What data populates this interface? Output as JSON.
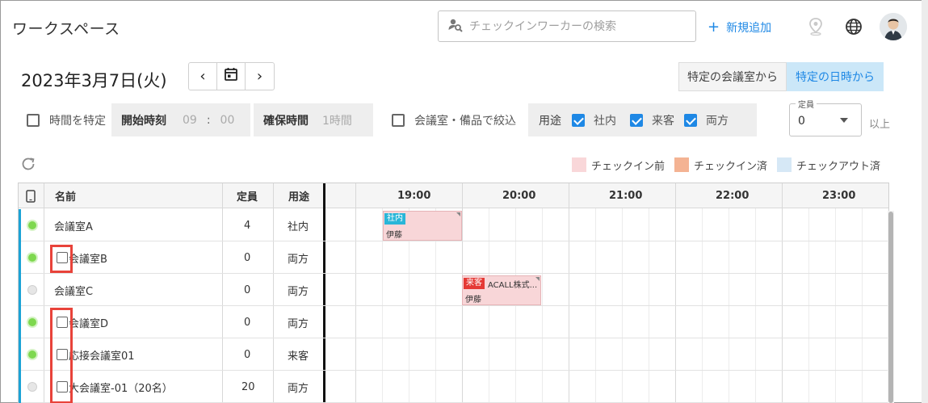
{
  "header": {
    "app_title": "ワークスペース",
    "search_placeholder": "チェックインワーカーの検索",
    "new_label": "新規追加",
    "icons": [
      "location-pin-icon",
      "globe-icon",
      "user-avatar"
    ]
  },
  "date": {
    "title": "2023年3月7日(火)",
    "prev": "‹",
    "next": "›"
  },
  "view_toggle": {
    "by_room": "特定の会議室から",
    "by_datetime": "特定の日時から",
    "active": "by_datetime"
  },
  "filters": {
    "specify_time_label": "時間を特定",
    "start_time_label": "開始時刻",
    "start_hour": "09",
    "start_sep": ":",
    "start_min": "00",
    "duration_label": "確保時間",
    "duration_value": "1時間",
    "narrow_label": "会議室・備品で絞込",
    "purpose_label": "用途",
    "purpose_internal": "社内",
    "purpose_visitor": "来客",
    "purpose_both": "両方",
    "capacity_legend": "定員",
    "capacity_value": "0",
    "capacity_suffix": "以上"
  },
  "legend": {
    "before_checkin": "チェックイン前",
    "checked_in": "チェックイン済",
    "checked_out": "チェックアウト済"
  },
  "colors": {
    "accent": "#1e88e5",
    "before_checkin": "#f9d7d9",
    "checked_in": "#f4b393",
    "checked_out": "#d6e8f6",
    "tag_internal": "#29b6d8",
    "tag_visitor": "#e53935",
    "highlight": "#e8433a"
  },
  "table": {
    "col_name": "名前",
    "col_capacity": "定員",
    "col_purpose": "用途",
    "hours": [
      "19:00",
      "20:00",
      "21:00",
      "22:00",
      "23:00"
    ],
    "rows": [
      {
        "name": "会議室A",
        "capacity": "4",
        "purpose": "社内",
        "status": "on",
        "checkbox": false
      },
      {
        "name": "会議室B",
        "capacity": "0",
        "purpose": "両方",
        "status": "on",
        "checkbox": true
      },
      {
        "name": "会議室C",
        "capacity": "0",
        "purpose": "両方",
        "status": "off",
        "checkbox": false
      },
      {
        "name": "会議室D",
        "capacity": "0",
        "purpose": "両方",
        "status": "on",
        "checkbox": true
      },
      {
        "name": "応接会議室01",
        "capacity": "0",
        "purpose": "来客",
        "status": "on",
        "checkbox": true
      },
      {
        "name": "大会議室-01（20名）",
        "capacity": "20",
        "purpose": "両方",
        "status": "off",
        "checkbox": true
      }
    ]
  },
  "events": [
    {
      "tag": "社内",
      "title": "",
      "person": "伊藤"
    },
    {
      "tag": "来客",
      "title": "ACALL株式...",
      "person": "伊藤"
    }
  ]
}
